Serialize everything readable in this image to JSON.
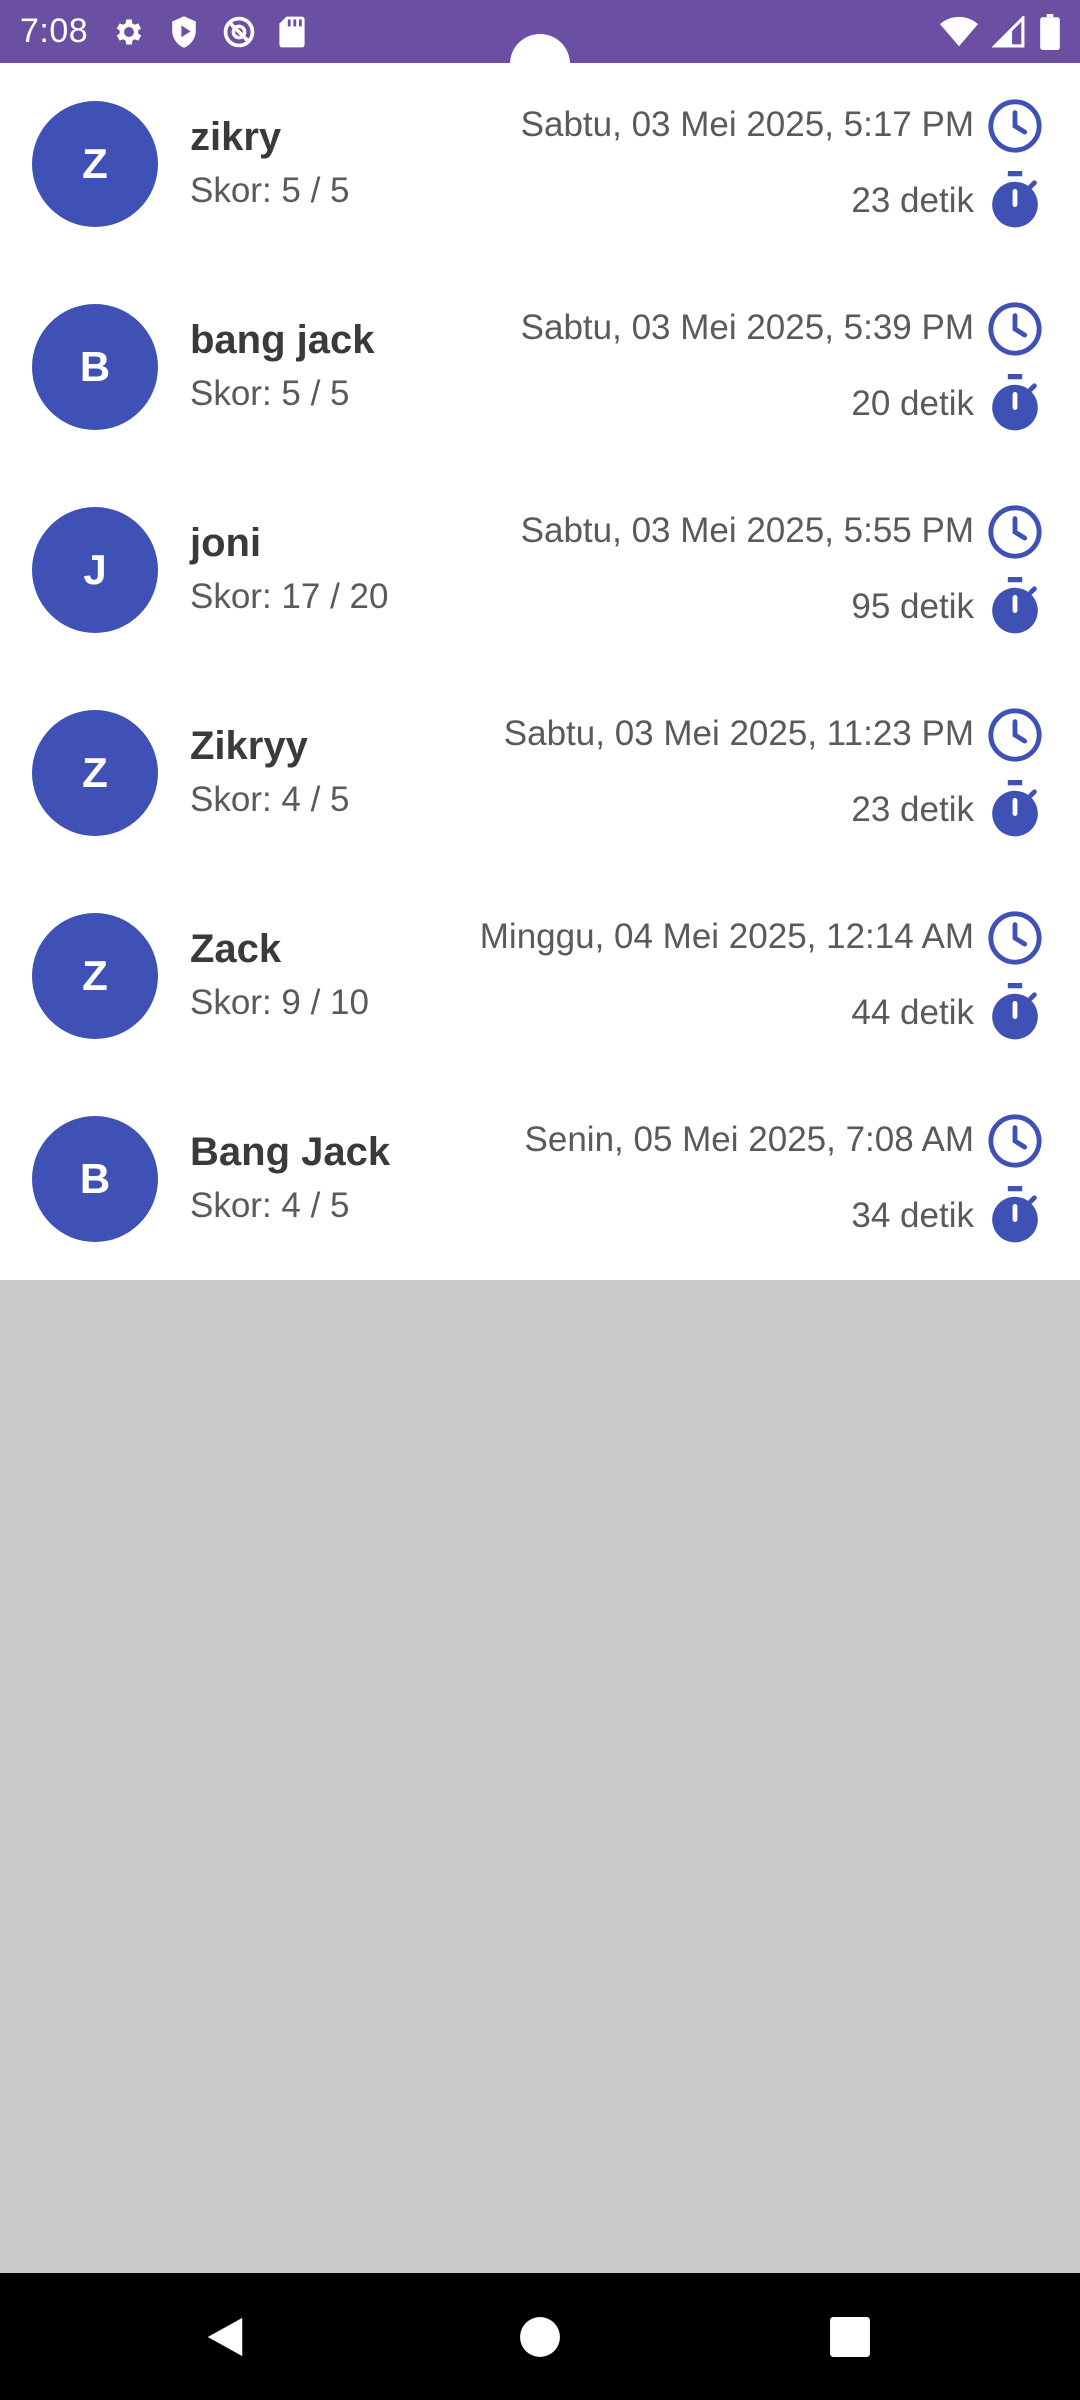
{
  "status_bar": {
    "time": "7:08",
    "left_icons": [
      "gear-icon",
      "shield-play-icon",
      "blocked-circle-icon",
      "sd-card-icon"
    ],
    "right_icons": [
      "wifi-icon",
      "cell-signal-icon",
      "battery-icon"
    ],
    "background_color": "#6a4fa3"
  },
  "accent_color": "#3f51b5",
  "history": {
    "items": [
      {
        "initial": "Z",
        "name": "zikry",
        "score": "Skor: 5 / 5",
        "date": "Sabtu, 03 Mei 2025, 5:17 PM",
        "duration": "23 detik"
      },
      {
        "initial": "B",
        "name": "bang jack",
        "score": "Skor: 5 / 5",
        "date": "Sabtu, 03 Mei 2025, 5:39 PM",
        "duration": "20 detik"
      },
      {
        "initial": "J",
        "name": "joni",
        "score": "Skor: 17 / 20",
        "date": "Sabtu, 03 Mei 2025, 5:55 PM",
        "duration": "95 detik"
      },
      {
        "initial": "Z",
        "name": "Zikryy",
        "score": "Skor: 4 / 5",
        "date": "Sabtu, 03 Mei 2025, 11:23 PM",
        "duration": "23 detik"
      },
      {
        "initial": "Z",
        "name": "Zack",
        "score": "Skor: 9 / 10",
        "date": "Minggu, 04 Mei 2025, 12:14 AM",
        "duration": "44 detik"
      },
      {
        "initial": "B",
        "name": "Bang Jack",
        "score": "Skor: 4 / 5",
        "date": "Senin, 05 Mei 2025, 7:08 AM",
        "duration": "34 detik"
      }
    ]
  },
  "nav_bar": {
    "buttons": [
      "back-icon",
      "home-icon",
      "recents-icon"
    ]
  }
}
